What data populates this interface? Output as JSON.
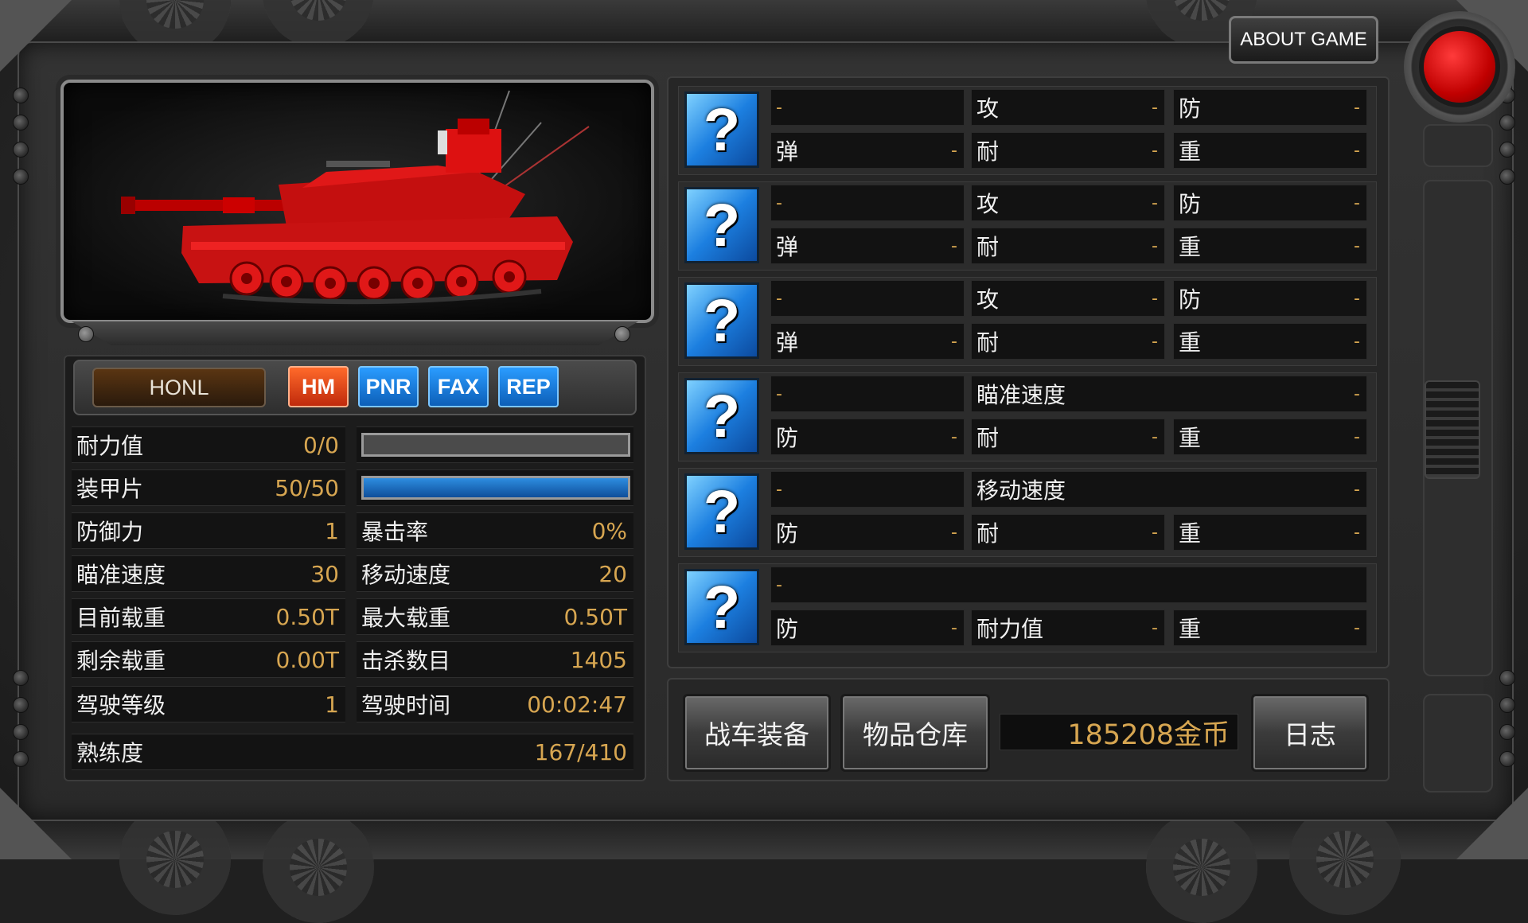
{
  "header": {
    "about_label": "ABOUT GAME"
  },
  "tank": {
    "name_tag": "HONL",
    "tags": [
      "HM",
      "PNR",
      "FAX",
      "REP"
    ],
    "body_color": "#d01010"
  },
  "stats": {
    "durability": {
      "label": "耐力值",
      "value": "0/0",
      "fill": 0
    },
    "armor": {
      "label": "装甲片",
      "value": "50/50",
      "fill": 1.0
    },
    "rows": [
      {
        "left_label": "防御力",
        "left_value": "1",
        "right_label": "暴击率",
        "right_value": "0%"
      },
      {
        "left_label": "瞄准速度",
        "left_value": "30",
        "right_label": "移动速度",
        "right_value": "20"
      },
      {
        "left_label": "目前载重",
        "left_value": "0.50T",
        "right_label": "最大载重",
        "right_value": "0.50T"
      },
      {
        "left_label": "剩余载重",
        "left_value": "0.00T",
        "right_label": "击杀数目",
        "right_value": "1405"
      },
      {
        "left_label": "驾驶等级",
        "left_value": "1",
        "right_label": "驾驶时间",
        "right_value": "00:02:47"
      }
    ],
    "proficiency": {
      "label": "熟练度",
      "value": "167/410"
    }
  },
  "equipment": [
    {
      "icon": "?",
      "name": "-",
      "r1c2": {
        "k": "攻",
        "v": "-"
      },
      "r1c3": {
        "k": "防",
        "v": "-"
      },
      "r2c1": {
        "k": "弹",
        "v": "-"
      },
      "r2c2": {
        "k": "耐",
        "v": "-"
      },
      "r2c3": {
        "k": "重",
        "v": "-"
      }
    },
    {
      "icon": "?",
      "name": "-",
      "r1c2": {
        "k": "攻",
        "v": "-"
      },
      "r1c3": {
        "k": "防",
        "v": "-"
      },
      "r2c1": {
        "k": "弹",
        "v": "-"
      },
      "r2c2": {
        "k": "耐",
        "v": "-"
      },
      "r2c3": {
        "k": "重",
        "v": "-"
      }
    },
    {
      "icon": "?",
      "name": "-",
      "r1c2": {
        "k": "攻",
        "v": "-"
      },
      "r1c3": {
        "k": "防",
        "v": "-"
      },
      "r2c1": {
        "k": "弹",
        "v": "-"
      },
      "r2c2": {
        "k": "耐",
        "v": "-"
      },
      "r2c3": {
        "k": "重",
        "v": "-"
      }
    },
    {
      "icon": "?",
      "name": "-",
      "wide": {
        "k": "瞄准速度",
        "v": "-"
      },
      "r2c1": {
        "k": "防",
        "v": "-"
      },
      "r2c2": {
        "k": "耐",
        "v": "-"
      },
      "r2c3": {
        "k": "重",
        "v": "-"
      }
    },
    {
      "icon": "?",
      "name": "-",
      "wide": {
        "k": "移动速度",
        "v": "-"
      },
      "r2c1": {
        "k": "防",
        "v": "-"
      },
      "r2c2": {
        "k": "耐",
        "v": "-"
      },
      "r2c3": {
        "k": "重",
        "v": "-"
      }
    },
    {
      "icon": "?",
      "full_name": "-",
      "r2c1": {
        "k": "防",
        "v": "-"
      },
      "r2c2": {
        "k": "耐力值",
        "v": "-"
      },
      "r2c3": {
        "k": "重",
        "v": "-"
      }
    }
  ],
  "footer": {
    "vehicle_equip": "战车装备",
    "warehouse": "物品仓库",
    "gold": "185208金币",
    "log": "日志"
  }
}
